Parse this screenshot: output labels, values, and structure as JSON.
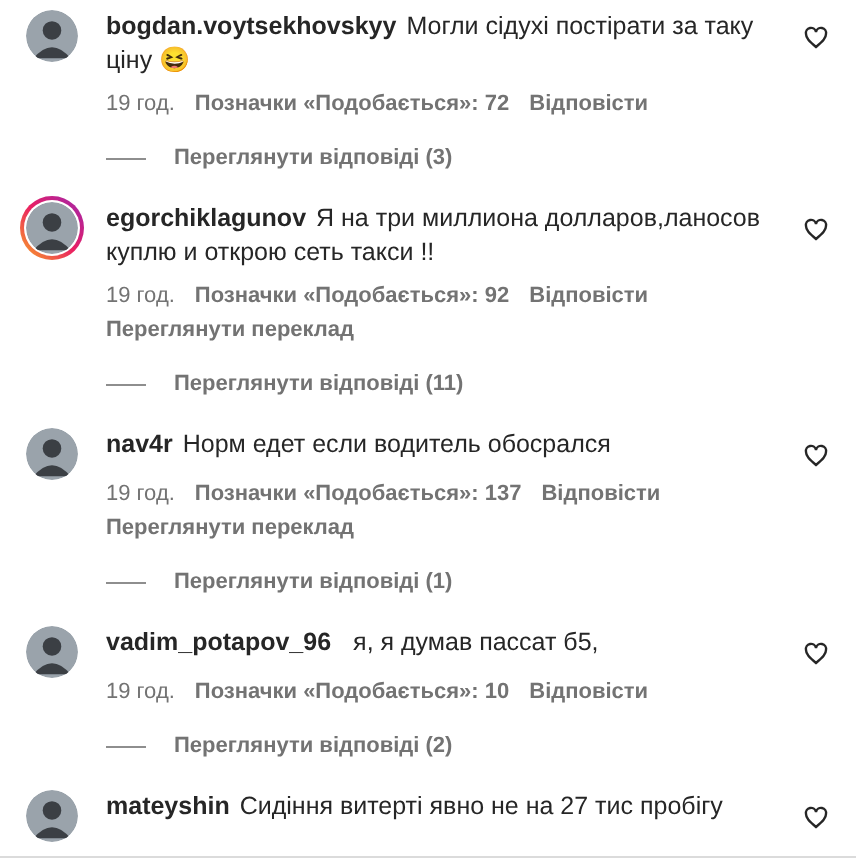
{
  "comments": [
    {
      "username": "bogdan.voytsekhovskyy",
      "text": "Могли сідухі постірати за таку ціну 😆",
      "story_ring": false,
      "time": "19 год.",
      "likes": "Позначки «Подобається»: 72",
      "reply": "Відповісти",
      "view_replies": "Переглянути відповіді (3)"
    },
    {
      "username": "egorchiklagunov",
      "text": "Я на три миллиона долларов,ланосов куплю и открою сеть такси !!",
      "story_ring": true,
      "time": "19 год.",
      "likes": "Позначки «Подобається»: 92",
      "reply": "Відповісти",
      "translation": "Переглянути переклад",
      "view_replies": "Переглянути відповіді (11)"
    },
    {
      "username": "nav4r",
      "text": "Норм едет если водитель обосрался",
      "story_ring": false,
      "time": "19 год.",
      "likes": "Позначки «Подобається»: 137",
      "reply": "Відповісти",
      "translation": "Переглянути переклад",
      "view_replies": "Переглянути відповіді (1)"
    },
    {
      "username": "vadim_potapov_96",
      "text": "я, я думав пассат б5,",
      "story_ring": false,
      "time": "19 год.",
      "likes": "Позначки «Подобається»: 10",
      "reply": "Відповісти",
      "view_replies": "Переглянути відповіді (2)"
    },
    {
      "username": "mateyshin",
      "text": "Сидіння витерті явно не на 27 тис пробігу",
      "story_ring": false
    }
  ]
}
